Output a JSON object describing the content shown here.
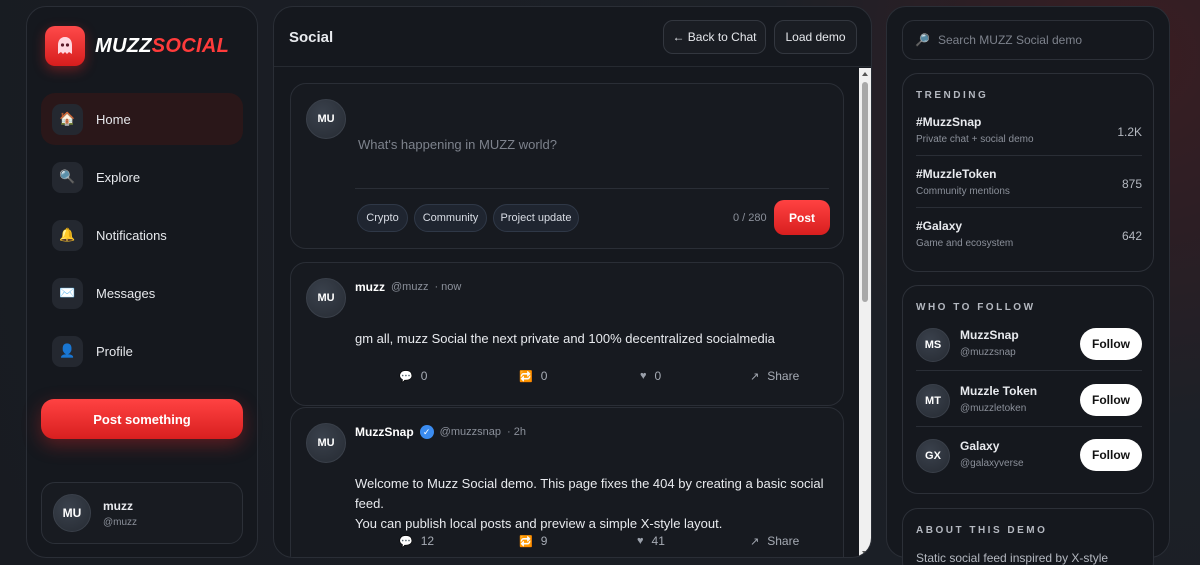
{
  "brand": {
    "part1": "MUZZ",
    "part2": "SOCIAL"
  },
  "nav": [
    {
      "label": "Home",
      "icon": "🏠"
    },
    {
      "label": "Explore",
      "icon": "🔍"
    },
    {
      "label": "Notifications",
      "icon": "🔔"
    },
    {
      "label": "Messages",
      "icon": "✉️"
    },
    {
      "label": "Profile",
      "icon": "👤"
    }
  ],
  "post_something": "Post something",
  "current_user": {
    "initials": "MU",
    "name": "muzz",
    "handle": "@muzz"
  },
  "main": {
    "title": "Social",
    "back_button": "← Back to Chat",
    "load_demo_button": "Load demo"
  },
  "composer": {
    "avatar": "MU",
    "placeholder": "What's happening in MUZZ world?",
    "chips": [
      "Crypto",
      "Community",
      "Project update"
    ],
    "counter": "0 / 280",
    "post_button": "Post"
  },
  "posts": [
    {
      "avatar": "MU",
      "name": "muzz",
      "handle": "@muzz",
      "time": "· now",
      "body": "gm all, muzz Social the next private and 100% decentralized socialmedia",
      "comments": "0",
      "reposts": "0",
      "likes": "0",
      "share": "Share"
    },
    {
      "avatar": "MU",
      "name": "MuzzSnap",
      "verified": "✓",
      "handle": "@muzzsnap",
      "time": "· 2h",
      "body_line1": "Welcome to Muzz Social demo. This page fixes the 404 by creating a basic social feed.",
      "body_line2": "You can publish local posts and preview a simple X-style layout.",
      "comments": "12",
      "reposts": "9",
      "likes": "41",
      "share": "Share"
    }
  ],
  "search": {
    "placeholder": "Search MUZZ Social demo"
  },
  "trending": {
    "title": "TRENDING",
    "items": [
      {
        "tag": "#MuzzSnap",
        "sub": "Private chat + social demo",
        "count": "1.2K"
      },
      {
        "tag": "#MuzzleToken",
        "sub": "Community mentions",
        "count": "875"
      },
      {
        "tag": "#Galaxy",
        "sub": "Game and ecosystem",
        "count": "642"
      }
    ]
  },
  "who_to_follow": {
    "title": "WHO TO FOLLOW",
    "items": [
      {
        "initials": "MS",
        "name": "MuzzSnap",
        "handle": "@muzzsnap",
        "button": "Follow"
      },
      {
        "initials": "MT",
        "name": "Muzzle Token",
        "handle": "@muzzletoken",
        "button": "Follow"
      },
      {
        "initials": "GX",
        "name": "Galaxy",
        "handle": "@galaxyverse",
        "button": "Follow"
      }
    ]
  },
  "about": {
    "title": "ABOUT THIS DEMO",
    "body": "Static social feed inspired by X-style"
  },
  "colors": {
    "accent": "#e82a2a",
    "verified": "#3b8cf0",
    "background": "#15181e"
  }
}
